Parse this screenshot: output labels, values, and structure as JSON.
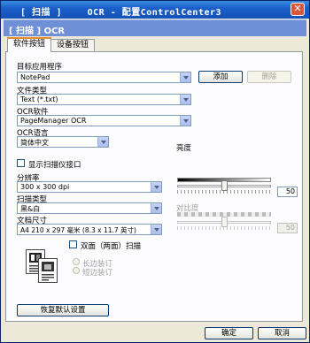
{
  "window": {
    "title": "OCR - 配置ControlCenter3",
    "title_bracket": "[ 扫描 ]",
    "close_glyph": "✕"
  },
  "header": {
    "text": "[ 扫描 ]  OCR"
  },
  "tabs": [
    {
      "label": "软件按钮",
      "active": true
    },
    {
      "label": "设备按钮",
      "active": false
    }
  ],
  "target_app": {
    "label": "目标应用程序",
    "value": "NotePad",
    "add_label": "添加",
    "delete_label": "删除"
  },
  "file_type": {
    "label": "文件类型",
    "value": "Text (*.txt)"
  },
  "ocr_software": {
    "label": "OCR软件",
    "value": "PageManager OCR"
  },
  "ocr_language": {
    "label": "OCR语言",
    "value": "简体中文"
  },
  "show_scanner_interface": {
    "label": "显示扫描仪接口",
    "checked": false
  },
  "resolution": {
    "label": "分辨率",
    "value": "300 x 300 dpi"
  },
  "scan_type": {
    "label": "扫描类型",
    "value": "黑&白"
  },
  "document_size": {
    "label": "文档尺寸",
    "value": "A4 210 x 297 毫米 (8.3 x 11.7 英寸)"
  },
  "duplex": {
    "label": "双面（两面）扫描",
    "checked": false,
    "long_edge": "长边装订",
    "short_edge": "短边装订"
  },
  "brightness": {
    "label": "亮度",
    "value": "50",
    "level": 0.5
  },
  "contrast": {
    "label": "对比度",
    "value": "50",
    "level": 0.5,
    "enabled": false
  },
  "restore_defaults": "恢复默认设置",
  "ok": "确定",
  "cancel": "取消",
  "colors": {
    "title_bar": "#1a5fc8",
    "header": "#6f8fd6",
    "window": "#ece9d8"
  }
}
